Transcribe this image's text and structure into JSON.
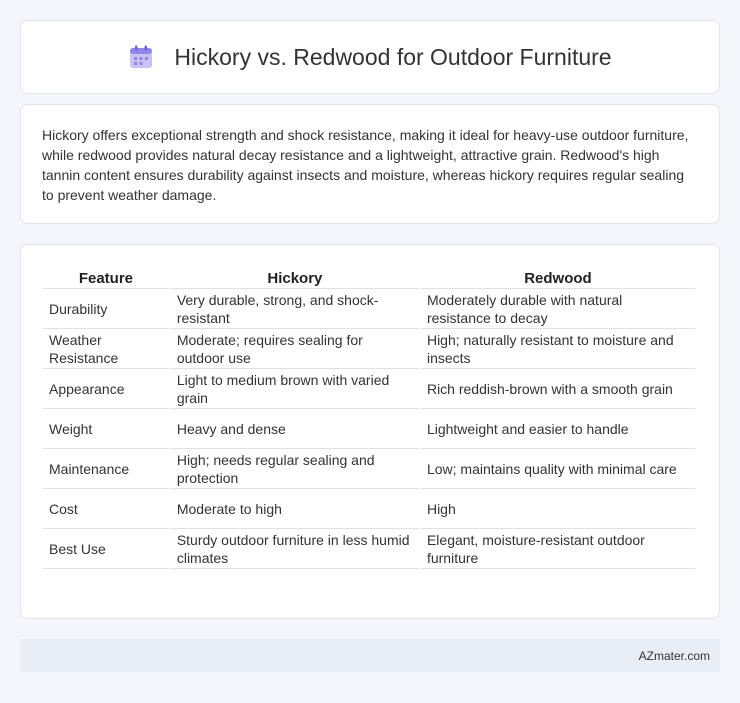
{
  "header": {
    "title": "Hickory vs. Redwood for Outdoor Furniture",
    "icon": "calendar-icon"
  },
  "summary": {
    "text": "Hickory offers exceptional strength and shock resistance, making it ideal for heavy-use outdoor furniture, while redwood provides natural decay resistance and a lightweight, attractive grain. Redwood's high tannin content ensures durability against insects and moisture, whereas hickory requires regular sealing to prevent weather damage."
  },
  "table": {
    "headers": [
      "Feature",
      "Hickory",
      "Redwood"
    ],
    "rows": [
      [
        "Durability",
        "Very durable, strong, and shock-resistant",
        "Moderately durable with natural resistance to decay"
      ],
      [
        "Weather Resistance",
        "Moderate; requires sealing for outdoor use",
        "High; naturally resistant to moisture and insects"
      ],
      [
        "Appearance",
        "Light to medium brown with varied grain",
        "Rich reddish-brown with a smooth grain"
      ],
      [
        "Weight",
        "Heavy and dense",
        "Lightweight and easier to handle"
      ],
      [
        "Maintenance",
        "High; needs regular sealing and protection",
        "Low; maintains quality with minimal care"
      ],
      [
        "Cost",
        "Moderate to high",
        "High"
      ],
      [
        "Best Use",
        "Sturdy outdoor furniture in less humid climates",
        "Elegant, moisture-resistant outdoor furniture"
      ]
    ]
  },
  "footer": {
    "text": "AZmater.com"
  }
}
